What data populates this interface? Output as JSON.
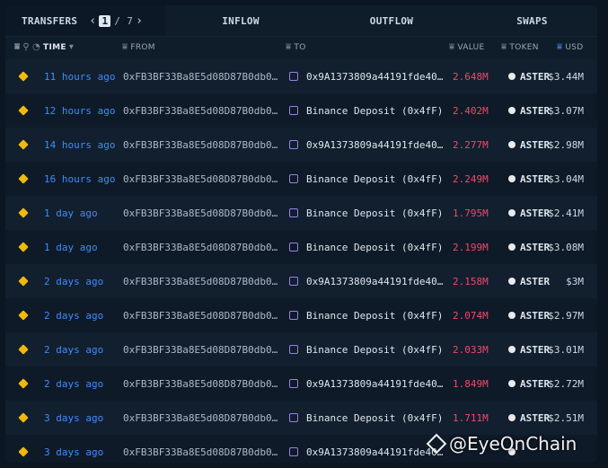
{
  "tabs": {
    "transfers": "TRANSFERS",
    "inflow": "INFLOW",
    "outflow": "OUTFLOW",
    "swaps": "SWAPS",
    "page_current": "1",
    "page_total": "/ 7"
  },
  "columns": {
    "time": "TIME",
    "from": "FROM",
    "to": "TO",
    "value": "VALUE",
    "token": "TOKEN",
    "usd": "USD"
  },
  "rows": [
    {
      "time": "11 hours ago",
      "from": "0xFB3BF33Ba8E5d08D87B0db0…",
      "to": "0x9A1373809a44191fde40…",
      "value": "2.648M",
      "token": "ASTER",
      "usd": "$3.44M"
    },
    {
      "time": "12 hours ago",
      "from": "0xFB3BF33Ba8E5d08D87B0db0…",
      "to": "Binance Deposit (0x4fF)",
      "value": "2.402M",
      "token": "ASTER",
      "usd": "$3.07M"
    },
    {
      "time": "14 hours ago",
      "from": "0xFB3BF33Ba8E5d08D87B0db0…",
      "to": "0x9A1373809a44191fde40…",
      "value": "2.277M",
      "token": "ASTER",
      "usd": "$2.98M"
    },
    {
      "time": "16 hours ago",
      "from": "0xFB3BF33Ba8E5d08D87B0db0…",
      "to": "Binance Deposit (0x4fF)",
      "value": "2.249M",
      "token": "ASTER",
      "usd": "$3.04M"
    },
    {
      "time": "1 day ago",
      "from": "0xFB3BF33Ba8E5d08D87B0db0…",
      "to": "Binance Deposit (0x4fF)",
      "value": "1.795M",
      "token": "ASTER",
      "usd": "$2.41M"
    },
    {
      "time": "1 day ago",
      "from": "0xFB3BF33Ba8E5d08D87B0db0…",
      "to": "Binance Deposit (0x4fF)",
      "value": "2.199M",
      "token": "ASTER",
      "usd": "$3.08M"
    },
    {
      "time": "2 days ago",
      "from": "0xFB3BF33Ba8E5d08D87B0db0…",
      "to": "0x9A1373809a44191fde40…",
      "value": "2.158M",
      "token": "ASTER",
      "usd": "$3M"
    },
    {
      "time": "2 days ago",
      "from": "0xFB3BF33Ba8E5d08D87B0db0…",
      "to": "Binance Deposit (0x4fF)",
      "value": "2.074M",
      "token": "ASTER",
      "usd": "$2.97M"
    },
    {
      "time": "2 days ago",
      "from": "0xFB3BF33Ba8E5d08D87B0db0…",
      "to": "Binance Deposit (0x4fF)",
      "value": "2.033M",
      "token": "ASTER",
      "usd": "$3.01M"
    },
    {
      "time": "2 days ago",
      "from": "0xFB3BF33Ba8E5d08D87B0db0…",
      "to": "0x9A1373809a44191fde40…",
      "value": "1.849M",
      "token": "ASTER",
      "usd": "$2.72M"
    },
    {
      "time": "3 days ago",
      "from": "0xFB3BF33Ba8E5d08D87B0db0…",
      "to": "Binance Deposit (0x4fF)",
      "value": "1.711M",
      "token": "ASTER",
      "usd": "$2.51M"
    },
    {
      "time": "3 days ago",
      "from": "0xFB3BF33Ba8E5d08D87B0db0…",
      "to": "0x9A1373809a44191fde40…",
      "value": "",
      "token": "",
      "usd": ""
    }
  ],
  "watermark": "@EyeOnChain",
  "colors": {
    "accent_time": "#3f8cff",
    "value_red": "#f2496a",
    "binance_yellow": "#f0b90b"
  }
}
